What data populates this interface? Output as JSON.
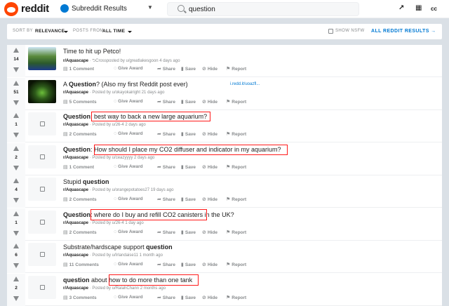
{
  "header": {
    "logo_text": "reddit",
    "subreddit_label": "Subreddit Results",
    "search_value": "question",
    "icons": [
      "trending-icon",
      "chart-icon",
      "chat-icon"
    ],
    "hdr_texts": [
      "↗",
      "▦",
      "cc"
    ]
  },
  "sortbar": {
    "sort_by_label": "SORT BY",
    "sort_by_value": "RELEVANCE",
    "posts_from_label": "POSTS FROM",
    "posts_from_value": "ALL TIME",
    "nsfw_label": "SHOW NSFW",
    "all_results_label": "ALL REDDIT RESULTS →"
  },
  "actions": {
    "give_award": "Give Award",
    "share": "Share",
    "save": "Save",
    "hide": "Hide",
    "report": "Report"
  },
  "posts": [
    {
      "score": "14",
      "title_html": "Time to hit up Petco!",
      "subreddit": "r/Aquascape",
      "meta": " · ⮌Crossposted by u/greatlakesgoon 4 days ago",
      "comments": "1 Comment",
      "thumb": "img1"
    },
    {
      "score": "51",
      "title_html": "A <b>Question</b>? (Also my first Reddit post ever)",
      "link": "i.redd.it/uoazfl...",
      "subreddit": "r/Aquascape",
      "meta": " · Posted by u/okayokairight 21 days ago",
      "comments": "5 Comments",
      "thumb": "img2"
    },
    {
      "score": "1",
      "title_html": "<b>Question</b>: best way to back a new large aquarium?",
      "subreddit": "r/Aquascape",
      "meta": " · Posted by u/26-4 2 days ago",
      "comments": "2 Comments",
      "thumb": "text"
    },
    {
      "score": "2",
      "title_html": "<b>Question</b>: How should I place my CO2 diffuser and indicator in my aquarium?",
      "subreddit": "r/Aquascape",
      "meta": " · Posted by u/ceazyyyy 2 days ago",
      "comments": "1 Comment",
      "thumb": "text"
    },
    {
      "score": "4",
      "title_html": "Stupid <b>question</b>",
      "subreddit": "r/Aquascape",
      "meta": " · Posted by u/orangepotatoes27 19 days ago",
      "comments": "2 Comments",
      "thumb": "text"
    },
    {
      "score": "1",
      "title_html": "<b>Question</b>: where do I buy and refill CO2 canisters in the UK?",
      "subreddit": "r/Aquascape",
      "meta": " · Posted by u/26-4 1 day ago",
      "comments": "2 Comments",
      "thumb": "text"
    },
    {
      "score": "6",
      "title_html": "Substrate/hardscape support <b>question</b>",
      "subreddit": "r/Aquascape",
      "meta": " · Posted by u/Irlandaise11 1 month ago",
      "comments": "11 Comments",
      "thumb": "text"
    },
    {
      "score": "2",
      "title_html": "<b>question</b> about how to do more than one tank",
      "subreddit": "r/Aquascape",
      "meta": " · Posted by u/RalahChann 2 months ago",
      "comments": "3 Comments",
      "thumb": "text"
    }
  ],
  "colors": {
    "highlight": "#ff1a1a",
    "accent": "#0079d3",
    "brand": "#ff4500"
  }
}
